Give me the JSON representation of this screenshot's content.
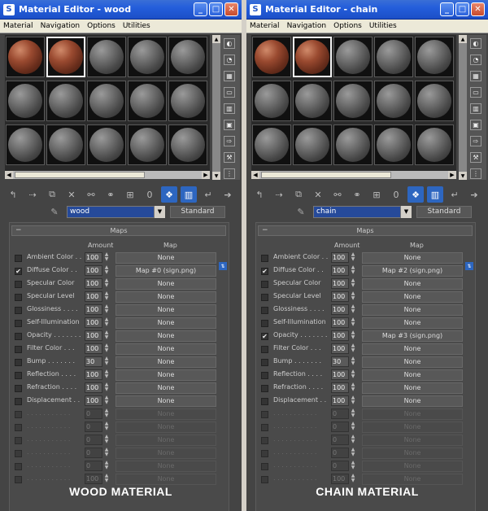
{
  "colors": {
    "titlebar": "#245edb",
    "slot_active": "#f2f2f2",
    "textured_sphere": "#9a4a30",
    "name_box": "#264a9a"
  },
  "icons": [
    "material-editor-icon",
    "minimize-icon",
    "maximize-icon",
    "close-icon",
    "sphere-type-icon",
    "backlight-icon",
    "checker-background-icon",
    "sample-uv-icon",
    "video-check-icon",
    "make-preview-icon",
    "options-icon",
    "select-by-material-icon",
    "navigator-icon",
    "get-material-icon",
    "put-to-scene-icon",
    "assign-to-selection-icon",
    "reset-icon",
    "copy-material-icon",
    "unique-icon",
    "put-to-library-icon",
    "material-id-icon",
    "show-map-in-viewport-icon",
    "show-end-result-icon",
    "go-to-parent-icon",
    "go-forward-icon",
    "eyedropper-icon"
  ],
  "menus": [
    "Material",
    "Navigation",
    "Options",
    "Utilities"
  ],
  "columns": {
    "amount": "Amount",
    "map": "Map"
  },
  "maps_rollout_title": "Maps",
  "material_type_label": "Standard",
  "left": {
    "title": "Material Editor - wood",
    "material_name": "wood",
    "caption": "WOOD MATERIAL",
    "rows": [
      {
        "label": "Ambient Color . .",
        "checked": false,
        "amount": "100",
        "map": "None"
      },
      {
        "label": "Diffuse Color . .",
        "checked": true,
        "amount": "100",
        "map": "Map #0 (sign.png)"
      },
      {
        "label": "Specular Color",
        "checked": false,
        "amount": "100",
        "map": "None"
      },
      {
        "label": "Specular Level",
        "checked": false,
        "amount": "100",
        "map": "None"
      },
      {
        "label": "Glossiness . . . .",
        "checked": false,
        "amount": "100",
        "map": "None"
      },
      {
        "label": "Self-Illumination",
        "checked": false,
        "amount": "100",
        "map": "None"
      },
      {
        "label": "Opacity . . . . . . .",
        "checked": false,
        "amount": "100",
        "map": "None"
      },
      {
        "label": "Filter Color . . .",
        "checked": false,
        "amount": "100",
        "map": "None"
      },
      {
        "label": "Bump . . . . . . .",
        "checked": false,
        "amount": "30",
        "map": "None"
      },
      {
        "label": "Reflection . . . .",
        "checked": false,
        "amount": "100",
        "map": "None"
      },
      {
        "label": "Refraction . . . .",
        "checked": false,
        "amount": "100",
        "map": "None"
      },
      {
        "label": "Displacement . .",
        "checked": false,
        "amount": "100",
        "map": "None"
      },
      {
        "label": ". . . . . . . . . . .",
        "checked": false,
        "amount": "0",
        "map": "None"
      },
      {
        "label": ". . . . . . . . . . .",
        "checked": false,
        "amount": "0",
        "map": "None"
      },
      {
        "label": ". . . . . . . . . . .",
        "checked": false,
        "amount": "0",
        "map": "None"
      },
      {
        "label": ". . . . . . . . . . .",
        "checked": false,
        "amount": "0",
        "map": "None"
      },
      {
        "label": ". . . . . . . . . . .",
        "checked": false,
        "amount": "0",
        "map": "None"
      },
      {
        "label": ". . . . . . . . . . .",
        "checked": false,
        "amount": "100",
        "map": "None"
      }
    ]
  },
  "right": {
    "title": "Material Editor - chain",
    "material_name": "chain",
    "caption": "CHAIN MATERIAL",
    "rows": [
      {
        "label": "Ambient Color . .",
        "checked": false,
        "amount": "100",
        "map": "None"
      },
      {
        "label": "Diffuse Color . .",
        "checked": true,
        "amount": "100",
        "map": "Map #2 (sign.png)"
      },
      {
        "label": "Specular Color",
        "checked": false,
        "amount": "100",
        "map": "None"
      },
      {
        "label": "Specular Level",
        "checked": false,
        "amount": "100",
        "map": "None"
      },
      {
        "label": "Glossiness . . . .",
        "checked": false,
        "amount": "100",
        "map": "None"
      },
      {
        "label": "Self-Illumination",
        "checked": false,
        "amount": "100",
        "map": "None"
      },
      {
        "label": "Opacity . . . . . . .",
        "checked": true,
        "amount": "100",
        "map": "Map #3 (sign.png)"
      },
      {
        "label": "Filter Color . . .",
        "checked": false,
        "amount": "100",
        "map": "None"
      },
      {
        "label": "Bump . . . . . . .",
        "checked": false,
        "amount": "30",
        "map": "None"
      },
      {
        "label": "Reflection . . . .",
        "checked": false,
        "amount": "100",
        "map": "None"
      },
      {
        "label": "Refraction . . . .",
        "checked": false,
        "amount": "100",
        "map": "None"
      },
      {
        "label": "Displacement . .",
        "checked": false,
        "amount": "100",
        "map": "None"
      },
      {
        "label": ". . . . . . . . . . .",
        "checked": false,
        "amount": "0",
        "map": "None"
      },
      {
        "label": ". . . . . . . . . . .",
        "checked": false,
        "amount": "0",
        "map": "None"
      },
      {
        "label": ". . . . . . . . . . .",
        "checked": false,
        "amount": "0",
        "map": "None"
      },
      {
        "label": ". . . . . . . . . . .",
        "checked": false,
        "amount": "0",
        "map": "None"
      },
      {
        "label": ". . . . . . . . . . .",
        "checked": false,
        "amount": "0",
        "map": "None"
      },
      {
        "label": ". . . . . . . . . . .",
        "checked": false,
        "amount": "100",
        "map": "None"
      }
    ]
  }
}
